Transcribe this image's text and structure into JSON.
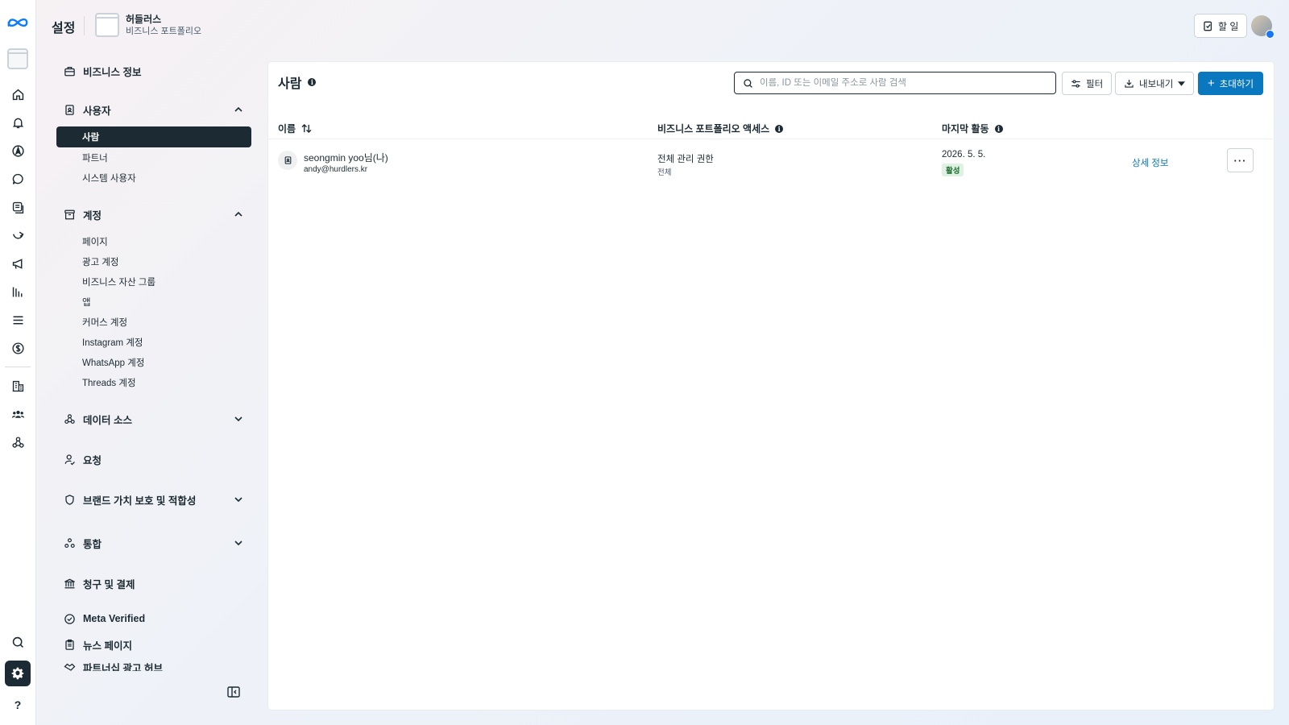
{
  "header": {
    "title": "설정",
    "portfolio_name": "허들러스",
    "portfolio_type": "비즈니스 포트폴리오",
    "todo_label": "할 일"
  },
  "sidebar": {
    "business_info": "비즈니스 정보",
    "users": {
      "label": "사용자",
      "items": [
        "사람",
        "파트너",
        "시스템 사용자"
      ],
      "active": "사람"
    },
    "accounts": {
      "label": "계정",
      "items": [
        "페이지",
        "광고 계정",
        "비즈니스 자산 그룹",
        "앱",
        "커머스 계정",
        "Instagram 계정",
        "WhatsApp 계정",
        "Threads 계정"
      ]
    },
    "data_sources": "데이터 소스",
    "requests": "요청",
    "brand_safety": "브랜드 가치 보호 및 적합성",
    "integrations": "통합",
    "billing": "청구 및 결제",
    "meta_verified": "Meta Verified",
    "news_page": "뉴스 페이지",
    "partnership_ads": "파트너십 광고 허브"
  },
  "main": {
    "title": "사람",
    "search_placeholder": "이름, ID 또는 이메일 주소로 사람 검색",
    "filter_label": "필터",
    "export_label": "내보내기",
    "invite_label": "초대하기",
    "columns": {
      "name": "이름",
      "access": "비즈니스 포트폴리오 액세스",
      "last_activity": "마지막 활동"
    },
    "rows": [
      {
        "name": "seongmin yoo님(나)",
        "email": "andy@hurdlers.kr",
        "access": "전체 관리 권한",
        "access_scope": "전체",
        "last_activity": "2026. 5. 5.",
        "status": "활성",
        "details_label": "상세 정보",
        "more_label": "···"
      }
    ]
  },
  "colors": {
    "primary": "#0a78be",
    "dark": "#1c2b33",
    "active_badge_bg": "#dff2e1",
    "active_badge_text": "#1f6d33"
  },
  "icons": {
    "rail": [
      "meta-logo-icon",
      "business-account-icon",
      "home-icon",
      "bell-icon",
      "compass-icon",
      "chat-icon",
      "content-icon",
      "automation-icon",
      "megaphone-icon",
      "bar-chart-icon",
      "menu-icon",
      "dollar-icon",
      "building-icon",
      "people-icon",
      "data-source-icon",
      "search-icon",
      "gear-icon",
      "help-icon"
    ]
  }
}
